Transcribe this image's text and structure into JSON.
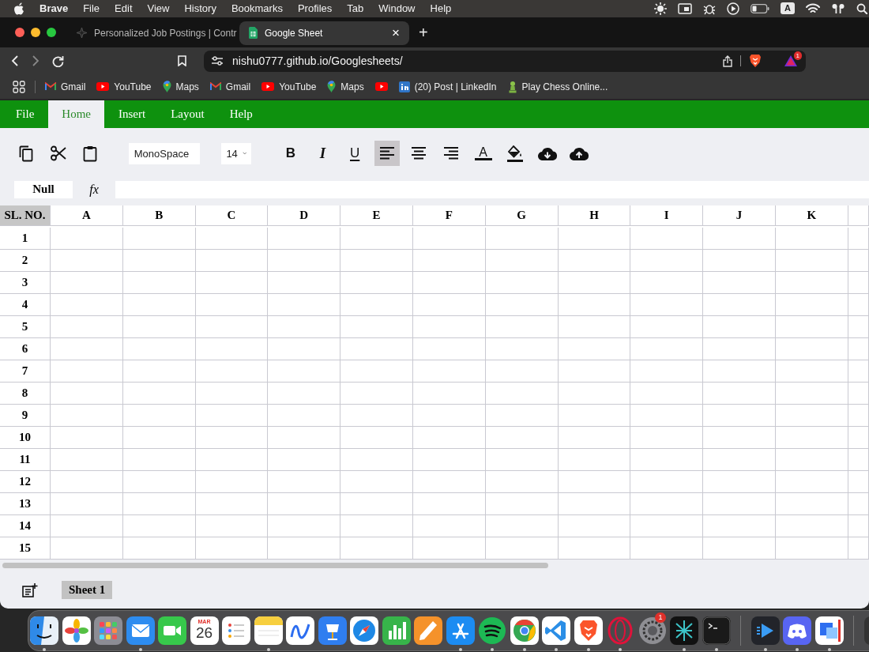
{
  "menubar": {
    "app": "Brave",
    "items": [
      "File",
      "Edit",
      "View",
      "History",
      "Bookmarks",
      "Profiles",
      "Tab",
      "Window",
      "Help"
    ],
    "input_source": "A"
  },
  "browser": {
    "tabs": [
      {
        "title": "Personalized Job Postings | Contr",
        "selected": false
      },
      {
        "title": "Google Sheet",
        "selected": true,
        "close": "×"
      }
    ],
    "new_tab": "+",
    "url": "nishu0777.github.io/Googlesheets/",
    "alerts_badge": "1",
    "bookmarks": [
      {
        "kind": "gmail",
        "label": "Gmail"
      },
      {
        "kind": "youtube",
        "label": "YouTube"
      },
      {
        "kind": "maps",
        "label": "Maps"
      },
      {
        "kind": "gmail",
        "label": "Gmail"
      },
      {
        "kind": "youtube",
        "label": "YouTube"
      },
      {
        "kind": "maps",
        "label": "Maps"
      },
      {
        "kind": "youtube"
      },
      {
        "kind": "linkedin",
        "label": "(20) Post | LinkedIn"
      },
      {
        "kind": "chess",
        "label": "Play Chess Online..."
      }
    ]
  },
  "app_menu": [
    {
      "label": "File",
      "selected": false
    },
    {
      "label": "Home",
      "selected": true
    },
    {
      "label": "Insert",
      "selected": false
    },
    {
      "label": "Layout",
      "selected": false
    },
    {
      "label": "Help",
      "selected": false
    }
  ],
  "toolbar": {
    "buttons": [
      {
        "kind": "copy"
      },
      {
        "kind": "cut"
      },
      {
        "kind": "paste"
      },
      {
        "kind": "font",
        "value": "MonoSpace"
      },
      {
        "kind": "size",
        "value": "14"
      },
      {
        "kind": "bold",
        "label": "B"
      },
      {
        "kind": "italic",
        "label": "I"
      },
      {
        "kind": "underline",
        "label": "U"
      },
      {
        "kind": "align-left",
        "selected": true
      },
      {
        "kind": "align-center",
        "selected": false
      },
      {
        "kind": "align-right",
        "selected": false
      },
      {
        "kind": "text-color",
        "label": "A"
      },
      {
        "kind": "fill-color"
      },
      {
        "kind": "download"
      },
      {
        "kind": "upload"
      }
    ]
  },
  "formula_bar": {
    "cell": "Null",
    "fx": "fx"
  },
  "sheet": {
    "corner": "SL. NO.",
    "columns": [
      "A",
      "B",
      "C",
      "D",
      "E",
      "F",
      "G",
      "H",
      "I",
      "J",
      "K"
    ],
    "rows": [
      "1",
      "2",
      "3",
      "4",
      "5",
      "6",
      "7",
      "8",
      "9",
      "10",
      "11",
      "12",
      "13",
      "14",
      "15"
    ]
  },
  "sheets": [
    {
      "name": "Sheet 1",
      "selected": true
    }
  ],
  "dock": {
    "apps": [
      {
        "kind": "finder",
        "running": true
      },
      {
        "kind": "photos",
        "running": false
      },
      {
        "kind": "launchpad",
        "running": false
      },
      {
        "kind": "mail",
        "running": true
      },
      {
        "kind": "facetime",
        "running": false
      },
      {
        "kind": "calendar",
        "month": "MAR",
        "day": "26",
        "running": false
      },
      {
        "kind": "reminders",
        "running": false
      },
      {
        "kind": "notes",
        "running": true
      },
      {
        "kind": "freeform",
        "running": false
      },
      {
        "kind": "keynote",
        "running": false
      },
      {
        "kind": "safari",
        "running": false
      },
      {
        "kind": "numbers",
        "running": false
      },
      {
        "kind": "pages",
        "running": false
      },
      {
        "kind": "appstore",
        "running": true
      },
      {
        "kind": "spotify",
        "running": true
      },
      {
        "kind": "chrome",
        "running": true
      },
      {
        "kind": "vscode",
        "running": true
      },
      {
        "kind": "brave",
        "running": true
      },
      {
        "kind": "opera",
        "running": true
      },
      {
        "kind": "settings",
        "badge": "1",
        "running": false
      },
      {
        "kind": "star",
        "running": true
      },
      {
        "kind": "terminal",
        "running": true
      },
      {
        "kind": "divider"
      },
      {
        "kind": "player",
        "running": true
      },
      {
        "kind": "discord",
        "running": true
      },
      {
        "kind": "windows",
        "running": true
      },
      {
        "kind": "divider"
      },
      {
        "kind": "dark",
        "running": false
      }
    ]
  }
}
